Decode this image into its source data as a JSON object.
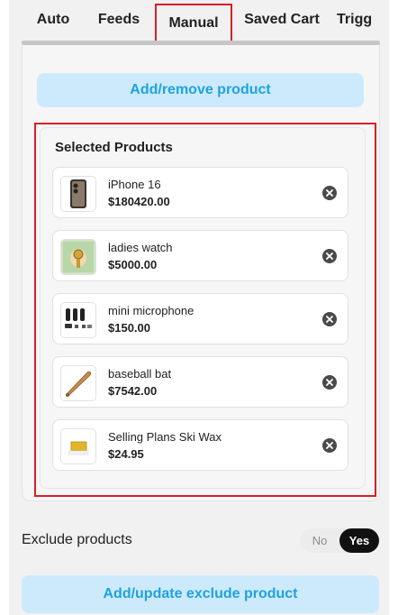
{
  "tabs": [
    {
      "label": "Auto"
    },
    {
      "label": "Feeds"
    },
    {
      "label": "Manual"
    },
    {
      "label": "Saved Cart"
    },
    {
      "label": "Trigg"
    }
  ],
  "active_tab": "Manual",
  "add_remove_button": "Add/remove product",
  "selected": {
    "title": "Selected Products",
    "products": [
      {
        "name": "iPhone 16",
        "price": "$180420.00",
        "thumb_icon": "phone-thumbnail-icon"
      },
      {
        "name": "ladies watch",
        "price": "$5000.00",
        "thumb_icon": "watch-thumbnail-icon"
      },
      {
        "name": "mini microphone",
        "price": "$150.00",
        "thumb_icon": "microphone-thumbnail-icon"
      },
      {
        "name": "baseball bat",
        "price": "$7542.00",
        "thumb_icon": "bat-thumbnail-icon"
      },
      {
        "name": "Selling Plans Ski Wax",
        "price": "$24.95",
        "thumb_icon": "wax-thumbnail-icon"
      }
    ]
  },
  "exclude": {
    "label": "Exclude products",
    "toggle_no": "No",
    "toggle_yes": "Yes",
    "value": "Yes"
  },
  "update_button": "Add/update exclude product",
  "colors": {
    "accent_text": "#1ea3e0",
    "button_bg": "#cdeafc",
    "highlight_border": "#d91f26",
    "toggle_active": "#111111"
  }
}
